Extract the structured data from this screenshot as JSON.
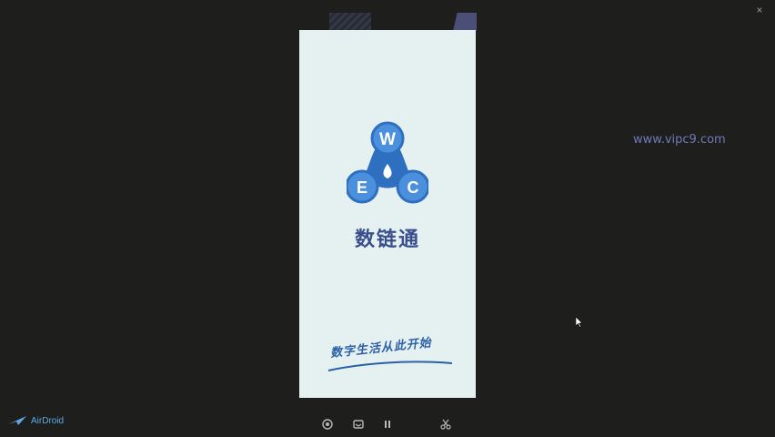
{
  "app": {
    "name": "数链通",
    "slogan": "数字生活从此开始",
    "logo_letters": [
      "W",
      "E",
      "C"
    ],
    "colors": {
      "logo_blue": "#4a90dd",
      "logo_dark": "#2f6fbf",
      "title": "#3a4d8c",
      "screen_bg": "#e5f1f1"
    }
  },
  "watermark": {
    "text": "www.vipc9.com"
  },
  "brand": {
    "name": "AirDroid",
    "icon": "airdroid-plane-icon"
  },
  "controls": {
    "icons": [
      "capture-icon",
      "screen-rotate-icon",
      "pause-icon",
      "scissors-icon"
    ],
    "close_icon": "close-icon",
    "close_glyph": "×"
  }
}
